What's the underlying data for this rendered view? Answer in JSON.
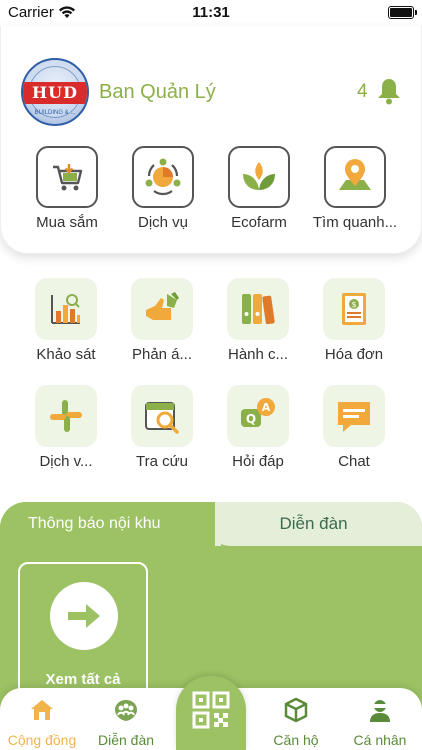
{
  "status_bar": {
    "carrier": "Carrier",
    "time": "11:31"
  },
  "header": {
    "logo_text": "HUD",
    "logo_subtext": "BUILDING & ...",
    "org_name": "Ban Quản Lý",
    "notification_count": "4"
  },
  "top_menu": [
    {
      "label": "Mua sắm",
      "icon": "shopping-cart-icon"
    },
    {
      "label": "Dịch vụ",
      "icon": "service-icon"
    },
    {
      "label": "Ecofarm",
      "icon": "leaf-icon"
    },
    {
      "label": "Tìm quanh...",
      "icon": "map-pin-icon"
    }
  ],
  "features": [
    {
      "label": "Khảo sát",
      "icon": "survey-chart-icon"
    },
    {
      "label": "Phản á...",
      "icon": "feedback-hand-icon"
    },
    {
      "label": "Hành c...",
      "icon": "binders-icon"
    },
    {
      "label": "Hóa đơn",
      "icon": "invoice-icon"
    },
    {
      "label": "Dịch v...",
      "icon": "slack-icon"
    },
    {
      "label": "Tra cứu",
      "icon": "calendar-search-icon"
    },
    {
      "label": "Hỏi đáp",
      "icon": "qa-bubble-icon"
    },
    {
      "label": "Chat",
      "icon": "chat-icon"
    }
  ],
  "tabs": {
    "active": "Thông báo nội khu",
    "inactive": "Diễn đàn"
  },
  "see_all": {
    "label": "Xem tất cả"
  },
  "bottom_nav": [
    {
      "label": "Cộng đồng",
      "icon": "home-icon",
      "active": true
    },
    {
      "label": "Diễn đàn",
      "icon": "group-icon",
      "active": false
    },
    {
      "label": "Căn hộ",
      "icon": "apartment-cube-icon",
      "active": false
    },
    {
      "label": "Cá nhân",
      "icon": "person-icon",
      "active": false
    }
  ],
  "colors": {
    "brand_green": "#9cc264",
    "text_green": "#8bb04a",
    "active_nav": "#f2b44a",
    "tab_text": "#3d6b50"
  }
}
